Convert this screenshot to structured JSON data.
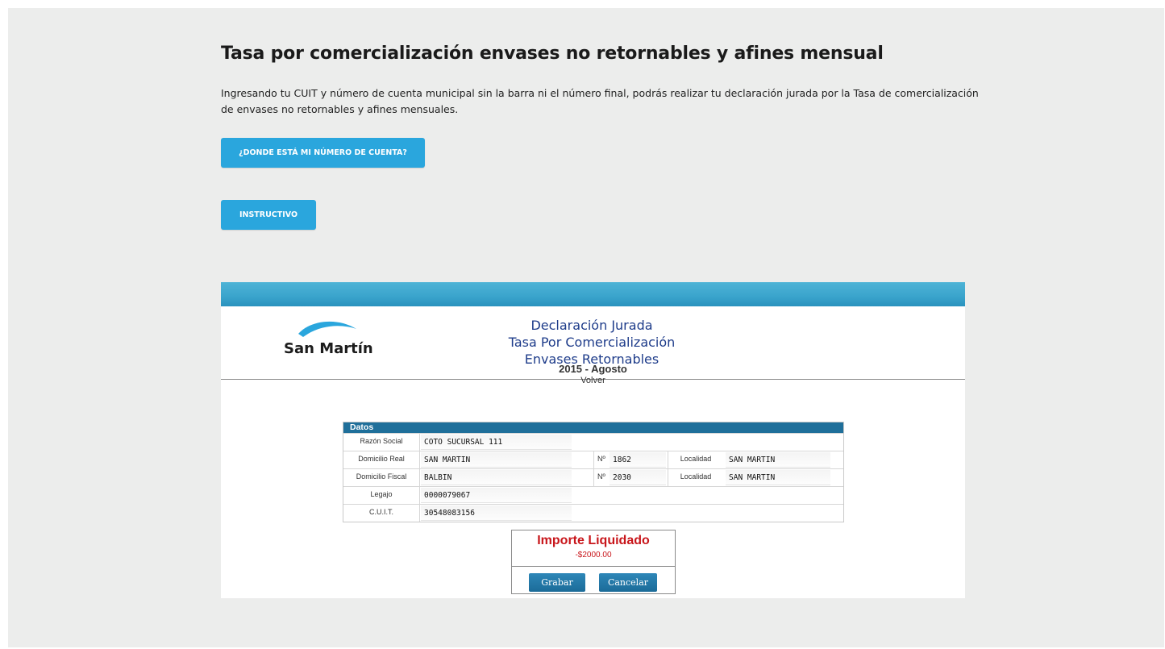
{
  "page": {
    "title": "Tasa por comercialización envases no retornables y afines mensual",
    "intro": "Ingresando tu CUIT y número de cuenta municipal sin la barra ni el número final, podrás realizar tu declaración jurada por la Tasa de comercialización de envases no retornables y afines mensuales.",
    "buttons": {
      "cuenta": "¿DONDE ESTÁ MI NÚMERO DE CUENTA?",
      "instructivo": "INSTRUCTIVO"
    }
  },
  "form": {
    "logo_text": "San Martín",
    "title_lines": [
      "Declaración Jurada",
      "Tasa Por Comercialización",
      "Envases Retornables"
    ],
    "period": "2015 - Agosto",
    "volver": "Volver",
    "datos_header": "Datos",
    "fields": {
      "razon_social": {
        "label": "Razón Social",
        "value": "COTO SUCURSAL 111"
      },
      "domicilio_real": {
        "label": "Domicilio Real",
        "value": "SAN MARTIN",
        "num_label": "Nº",
        "num": "1862",
        "loc_label": "Localidad",
        "loc": "SAN MARTIN"
      },
      "domicilio_fiscal": {
        "label": "Domicilio Fiscal",
        "value": "BALBIN",
        "num_label": "Nº",
        "num": "2030",
        "loc_label": "Localidad",
        "loc": "SAN MARTIN"
      },
      "legajo": {
        "label": "Legajo",
        "value": "0000079067"
      },
      "cuit": {
        "label": "C.U.I.T.",
        "value": "30548083156"
      }
    },
    "importe": {
      "title": "Importe Liquidado",
      "value": "-$2000.00"
    },
    "actions": {
      "grabar": "Grabar",
      "cancelar": "Cancelar"
    }
  },
  "colors": {
    "background": "#ecedec",
    "accent": "#2aa6dd",
    "form_header": "#1f6f9a",
    "importe": "#c8161b",
    "form_title": "#1e3c8a"
  }
}
